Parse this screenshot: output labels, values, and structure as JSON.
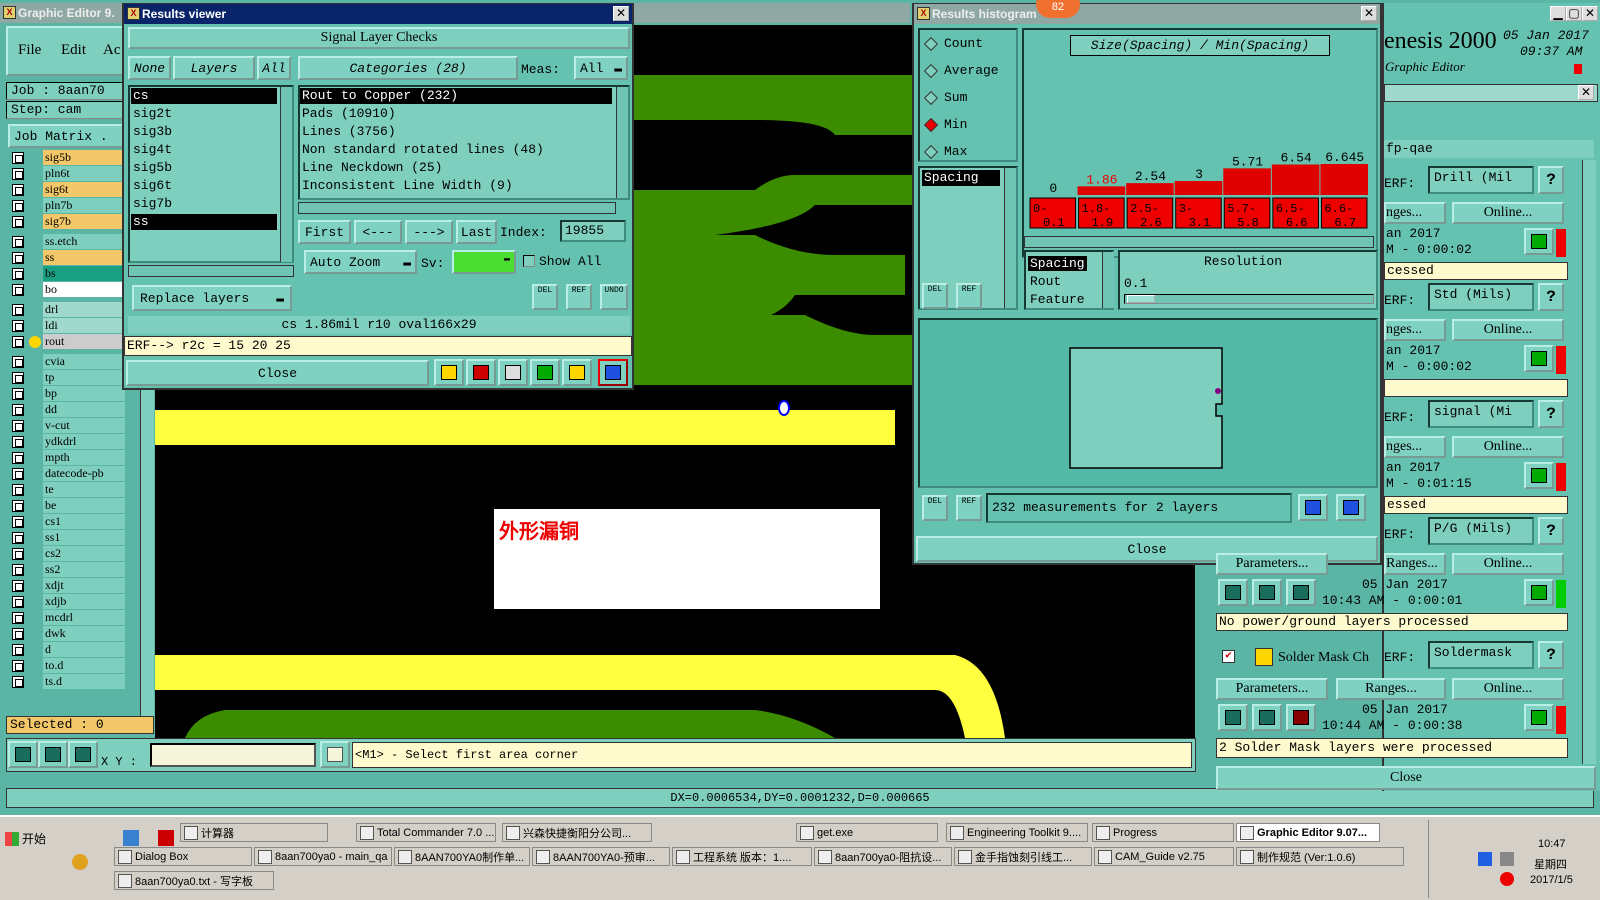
{
  "main": {
    "title": "Graphic Editor 9.",
    "menu": [
      "File",
      "Edit",
      "Ac"
    ],
    "job": "Job : 8aan70",
    "step": "Step: cam",
    "job_matrix": "Job Matrix .",
    "layers": [
      "sig5b",
      "pln6t",
      "sig6t",
      "pln7b",
      "sig7b",
      "ss.etch",
      "ss",
      "bs",
      "bo",
      "drl",
      "ldi",
      "rout",
      "cvia",
      "tp",
      "bp",
      "dd",
      "v-cut",
      "ydkdrl",
      "mpth",
      "datecode-pb",
      "te",
      "be",
      "cs1",
      "ss1",
      "cs2",
      "ss2",
      "xdjt",
      "xdjb",
      "mcdrl",
      "dwk",
      "d",
      "to.d",
      "ts.d"
    ],
    "selected": "Selected : 0",
    "xy_label": "X Y :",
    "prompt": "<M1> - Select first area corner",
    "dxdy": "DX=0.0006534,DY=0.0001232,D=0.000665",
    "annotation": "外形漏铜"
  },
  "results_viewer": {
    "title": "Results viewer",
    "header": "Signal Layer Checks",
    "none_btn": "None",
    "layers_btn": "Layers",
    "all_btn": "All",
    "categories_btn": "Categories (28)",
    "meas_label": "Meas:",
    "meas_value": "All",
    "layer_list": [
      "cs",
      "sig2t",
      "sig3b",
      "sig4t",
      "sig5b",
      "sig6t",
      "sig7b",
      "ss"
    ],
    "categories": [
      "Rout to Copper (232)",
      "Pads (10910)",
      "Lines (3756)",
      "Non standard rotated lines (48)",
      "Line Neckdown (25)",
      "Inconsistent Line Width (9)"
    ],
    "first": "First",
    "prev": "<---",
    "next": "--->",
    "last": "Last",
    "index_label": "Index:",
    "index_value": "19855",
    "auto_zoom": "Auto Zoom",
    "sv_label": "Sv:",
    "show_all": "Show All",
    "replace_layers": "Replace layers",
    "info": "cs 1.86mil   r10   oval166x29",
    "erf": "ERF--> r2c = 15 20 25",
    "close": "Close",
    "del": "DEL",
    "ref": "REF",
    "undo": "UNDO"
  },
  "histogram": {
    "title": "Results histogram",
    "badge": "82",
    "options": [
      "Count",
      "Average",
      "Sum",
      "Min",
      "Max"
    ],
    "selected_option": "Min",
    "chart_title": "Size(Spacing) / Min(Spacing)",
    "list_item": "Spacing",
    "attr_list": [
      "Spacing",
      "Rout",
      "Feature"
    ],
    "resolution_label": "Resolution",
    "resolution_value": "0.1",
    "measurements": "232 measurements for 2 layers",
    "close": "Close",
    "del": "DEL",
    "ref": "REF"
  },
  "chart_data": {
    "type": "bar",
    "title": "Size(Spacing) / Min(Spacing)",
    "categories": [
      "0-0.1",
      "1.8-1.9",
      "2.5-2.6",
      "3-3.1",
      "5.7-5.8",
      "6.5-6.6",
      "6.6-6.7"
    ],
    "values": [
      0,
      1.86,
      2.54,
      3,
      5.71,
      6.54,
      6.645
    ],
    "value_labels": [
      "0",
      "1.86",
      "2.54",
      "3",
      "5.71",
      "6.54",
      "6.645"
    ],
    "color": "#e00000"
  },
  "right": {
    "brand": "enesis 2000",
    "date": "05 Jan 2017",
    "time": "09:37 AM",
    "subtitle": "Graphic Editor",
    "job": "fp-qae",
    "erf_label": "ERF:",
    "rows": [
      {
        "erf": "Drill (Mil",
        "ranges": "nges...",
        "online": "Online...",
        "date": "an 2017",
        "time": "M - 0:00:02",
        "status": "cessed",
        "color": "#e00"
      },
      {
        "erf": "Std (Mils)",
        "ranges": "nges...",
        "online": "Online...",
        "date": "an 2017",
        "time": "M - 0:00:02",
        "status": "",
        "color": "#e00"
      },
      {
        "erf": "signal (Mi",
        "ranges": "nges...",
        "online": "Online...",
        "date": "an 2017",
        "time": "M - 0:01:15",
        "status": "essed",
        "color": "#e00"
      },
      {
        "erf": "P/G (Mils)",
        "ranges": "Ranges...",
        "online": "Online...",
        "date": "05 Jan 2017",
        "time": "10:43 AM - 0:00:01",
        "status": "No power/ground layers processed",
        "color": "#0c0"
      }
    ],
    "solder_title": "Solder Mask Ch",
    "solder_erf": "Soldermask",
    "parameters": "Parameters...",
    "ranges": "Ranges...",
    "online": "Online...",
    "solder_date": "05 Jan 2017",
    "solder_time": "10:44 AM - 0:00:38",
    "solder_status": "2 Solder Mask layers were processed",
    "close": "Close"
  },
  "taskbar": {
    "start": "开始",
    "row1": [
      "计算器",
      "Total Commander 7.0 ...",
      "兴森快捷衡阳分公司...",
      "get.exe",
      "Engineering Toolkit 9....",
      "Progress",
      "Graphic Editor 9.07..."
    ],
    "row2": [
      "Dialog Box",
      "8aan700ya0 - main_qa",
      "8AAN700YA0制作单...",
      "8AAN700YA0-预审...",
      "工程系统   版本：1....",
      "8aan700ya0-阻抗设...",
      "金手指蚀刻引线工...",
      "CAM_Guide v2.75",
      "制作规范 (Ver:1.0.6)"
    ],
    "row3": [
      "8aan700ya0.txt - 写字板"
    ],
    "clock": "10:47",
    "weekday": "星期四",
    "date": "2017/1/5"
  }
}
